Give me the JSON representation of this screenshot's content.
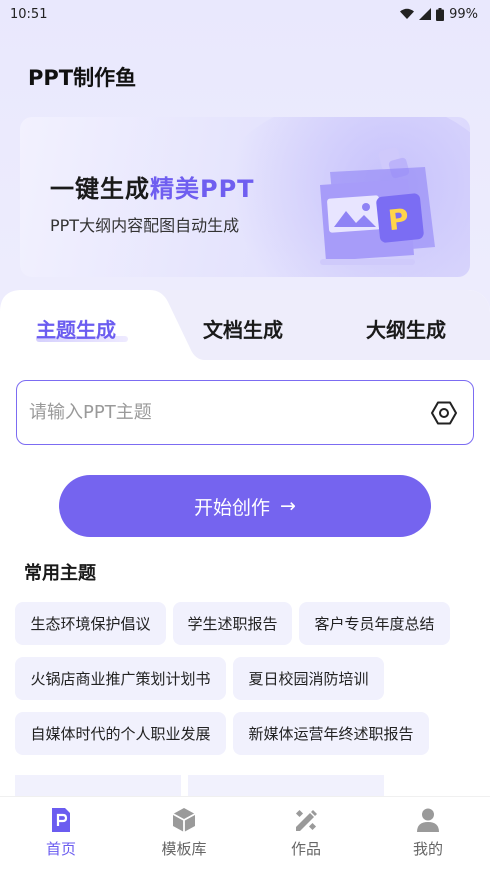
{
  "status": {
    "time": "10:51",
    "battery": "99%"
  },
  "app": {
    "title": "PPT制作鱼"
  },
  "banner": {
    "title_main": "一键生成",
    "title_accent": "精美PPT",
    "subtitle": "PPT大纲内容配图自动生成"
  },
  "tabs": [
    {
      "label": "主题生成",
      "active": true
    },
    {
      "label": "文档生成",
      "active": false
    },
    {
      "label": "大纲生成",
      "active": false
    }
  ],
  "input": {
    "placeholder": "请输入PPT主题",
    "value": ""
  },
  "start_button": {
    "label": "开始创作",
    "arrow": "→"
  },
  "common_topics": {
    "title": "常用主题",
    "items": [
      "生态环境保护倡议",
      "学生述职报告",
      "客户专员年度总结",
      "火锅店商业推广策划计划书",
      "夏日校园消防培训",
      "自媒体时代的个人职业发展",
      "新媒体运营年终述职报告"
    ]
  },
  "bottom_nav": [
    {
      "label": "首页",
      "icon": "ppt-home-icon",
      "active": true
    },
    {
      "label": "模板库",
      "icon": "cube-icon",
      "active": false
    },
    {
      "label": "作品",
      "icon": "pencil-ruler-icon",
      "active": false
    },
    {
      "label": "我的",
      "icon": "user-icon",
      "active": false
    }
  ],
  "colors": {
    "accent": "#7564ef",
    "accent_text": "#6b5cf0",
    "chip_bg": "#f1f1fd"
  }
}
